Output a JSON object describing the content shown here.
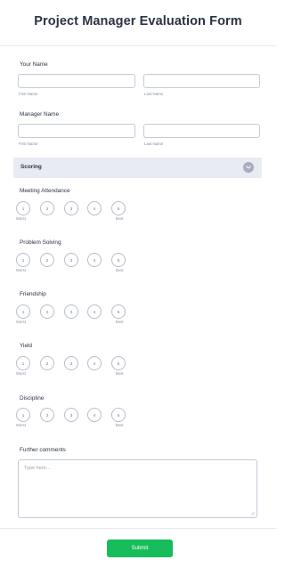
{
  "form": {
    "title": "Project Manager Evaluation Form"
  },
  "your_name": {
    "label": "Your Name",
    "first_sublabel": "First Name",
    "last_sublabel": "Last Name"
  },
  "manager_name": {
    "label": "Manager Name",
    "first_sublabel": "First Name",
    "last_sublabel": "Last Name"
  },
  "scoring_section": {
    "title": "Scoring",
    "collapse_icon": "chevron-down-icon"
  },
  "scale": {
    "options": [
      "1",
      "2",
      "3",
      "4",
      "5"
    ],
    "worst_label": "Worst",
    "best_label": "Best"
  },
  "ratings": [
    {
      "label": "Meeting Attendance"
    },
    {
      "label": "Problem Solving"
    },
    {
      "label": "Friendship"
    },
    {
      "label": "Yield"
    },
    {
      "label": "Discipline"
    }
  ],
  "comments": {
    "label": "Further comments",
    "placeholder": "Type here..."
  },
  "submit": {
    "label": "Submit",
    "color": "#18bd5b"
  }
}
